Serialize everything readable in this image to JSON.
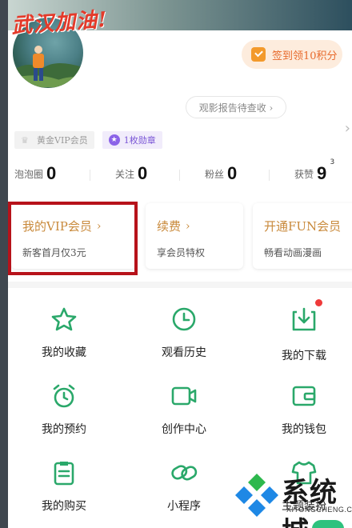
{
  "profile": {
    "avatar_text": "武汉加油!",
    "checkin_label": "签到领10积分",
    "report_label": "观影报告待查收 ›",
    "vip_badge": "黄金VIP会员",
    "medal_badge": "1枚勋章"
  },
  "stats": [
    {
      "label": "泡泡圈",
      "value": "0"
    },
    {
      "label": "关注",
      "value": "0"
    },
    {
      "label": "粉丝",
      "value": "0"
    },
    {
      "label": "获赞",
      "value": "9",
      "sup": "3"
    }
  ],
  "cards": {
    "vip": {
      "title": "我的VIP会员",
      "chevron": "›",
      "sub": "新客首月仅3元"
    },
    "renew": {
      "title": "续费",
      "chevron": "›",
      "sub": "享会员特权"
    },
    "fun": {
      "title": "开通FUN会员",
      "sub": "畅看动画漫画"
    }
  },
  "grid": [
    {
      "label": "我的收藏",
      "icon": "star-icon"
    },
    {
      "label": "观看历史",
      "icon": "clock-icon"
    },
    {
      "label": "我的下载",
      "icon": "download-icon"
    },
    {
      "label": "我的预约",
      "icon": "alarm-icon"
    },
    {
      "label": "创作中心",
      "icon": "video-camera-icon"
    },
    {
      "label": "我的钱包",
      "icon": "wallet-icon"
    },
    {
      "label": "我的购买",
      "icon": "clipboard-icon"
    },
    {
      "label": "小程序",
      "icon": "link-icon"
    },
    {
      "label": "主题装扮",
      "icon": "shirt-icon"
    }
  ],
  "watermark": {
    "brand": "系统城",
    "url": "XITONGCHENG.COM"
  },
  "colors": {
    "accent_green": "#2aa86a",
    "vip_gold": "#c98a3c",
    "checkin_orange": "#e86a2c",
    "highlight_red": "#b7121a"
  }
}
